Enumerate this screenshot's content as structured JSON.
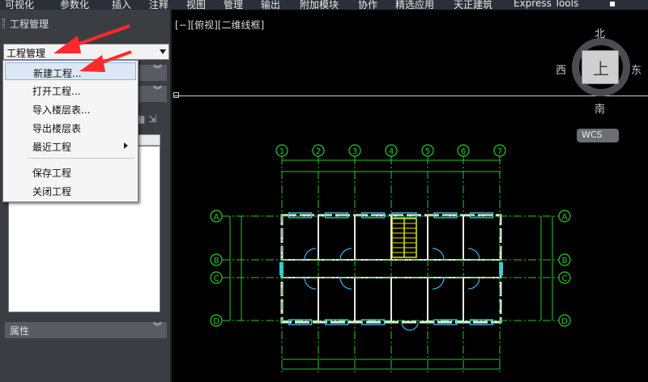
{
  "menubar": {
    "items": [
      "可视化",
      "参数化",
      "插入",
      "注释",
      "视图",
      "管理",
      "输出",
      "附加模块",
      "协作",
      "精选应用",
      "天正建筑",
      "Express Tools"
    ]
  },
  "panel": {
    "title": "工程管理",
    "combo_value": "工程管理",
    "properties_label": "属性",
    "chevron": "»"
  },
  "dropdown": {
    "items": [
      {
        "label": "新建工程...",
        "highlighted": true
      },
      {
        "label": "打开工程..."
      },
      {
        "label": "导入楼层表..."
      },
      {
        "label": "导出楼层表"
      },
      {
        "label": "最近工程",
        "submenu": true
      },
      {
        "label": "保存工程"
      },
      {
        "label": "关闭工程"
      }
    ]
  },
  "viewport": {
    "label": "[−][俯视][二维线框]"
  },
  "viewcube": {
    "north": "北",
    "south": "南",
    "east": "东",
    "west": "西",
    "face": "上",
    "ucs": "WCS"
  },
  "plan": {
    "column_axes": [
      "1",
      "2",
      "3",
      "4",
      "5",
      "6",
      "7"
    ],
    "row_axes": [
      "A",
      "B",
      "C",
      "D"
    ]
  },
  "colors": {
    "axis_green": "#22cc22",
    "wall_white": "#e8e8e8",
    "window_cyan": "#3fc9e0",
    "door_cyan": "#3fa9e0",
    "stair_yellow": "#e6e600",
    "red_arrow": "#ff2a2a"
  }
}
